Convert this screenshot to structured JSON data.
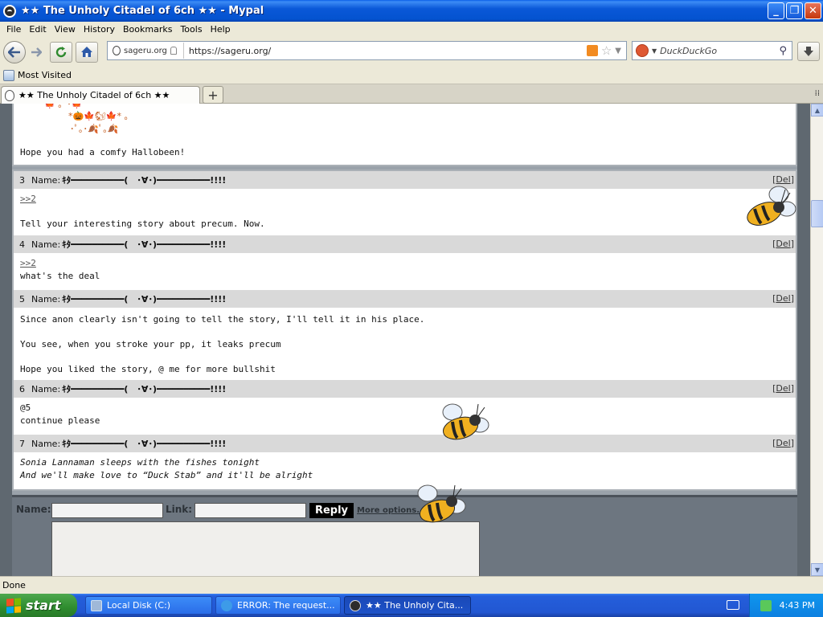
{
  "window": {
    "title": "★★ The Unholy Citadel of 6ch ★★ - Mypal",
    "minimize": "_",
    "maximize": "❐",
    "close": "✕"
  },
  "menu": [
    "File",
    "Edit",
    "View",
    "History",
    "Bookmarks",
    "Tools",
    "Help"
  ],
  "nav": {
    "site_identity": "sageru.org",
    "url": "https://sageru.org/",
    "search_placeholder": "DuckDuckGo"
  },
  "bookmarks": {
    "most_visited": "Most Visited"
  },
  "tab": {
    "title": "★★ The Unholy Citadel of 6ch ★★"
  },
  "op": {
    "art_line1": "*🎃🍁🐿🍁* ｡",
    "art_line2": "･ﾟ｡･🍂ﾟ｡🍂",
    "text": "Hope you had a comfy Hallobeen!"
  },
  "posts": [
    {
      "num": "3",
      "name_label": "Name:",
      "author": "ｷﾀ━━━━━━━━━━(　･∀･)━━━━━━━━━━!!!!",
      "del": "Del",
      "ref": ">>2",
      "lines": [
        "Tell your interesting story about precum. Now."
      ]
    },
    {
      "num": "4",
      "name_label": "Name:",
      "author": "ｷﾀ━━━━━━━━━━(　･∀･)━━━━━━━━━━!!!!",
      "del": "Del",
      "ref": ">>2",
      "lines": [
        "what's the deal"
      ]
    },
    {
      "num": "5",
      "name_label": "Name:",
      "author": "ｷﾀ━━━━━━━━━━(　･∀･)━━━━━━━━━━!!!!",
      "del": "Del",
      "lines": [
        "Since anon clearly isn't going to tell the story, I'll tell it in his place.",
        "You see, when you stroke your pp, it leaks precum",
        "Hope you liked the story, @ me for more bullshit"
      ]
    },
    {
      "num": "6",
      "name_label": "Name:",
      "author": "ｷﾀ━━━━━━━━━━(　･∀･)━━━━━━━━━━!!!!",
      "del": "Del",
      "lines": [
        "@5",
        "continue please"
      ]
    },
    {
      "num": "7",
      "name_label": "Name:",
      "author": "ｷﾀ━━━━━━━━━━(　･∀･)━━━━━━━━━━!!!!",
      "del": "Del",
      "lines": [
        "Sonia Lannaman sleeps with the fishes tonight",
        "And we'll make love to “Duck Stab” and it'll be alright"
      ]
    }
  ],
  "reply_form": {
    "name_label": "Name:",
    "link_label": "Link:",
    "reply_button": "Reply",
    "more_options": "More options..."
  },
  "status": {
    "text": "Done"
  },
  "taskbar": {
    "start": "start",
    "tasks": [
      "Local Disk (C:)",
      "ERROR: The request...",
      "★★ The Unholy Cita..."
    ],
    "clock": "4:43 PM"
  },
  "colors": {
    "titlebar": "#0453d0",
    "post_header": "#d9d9d9",
    "reply_button": "#000000",
    "start_green": "#2e8c2e"
  }
}
